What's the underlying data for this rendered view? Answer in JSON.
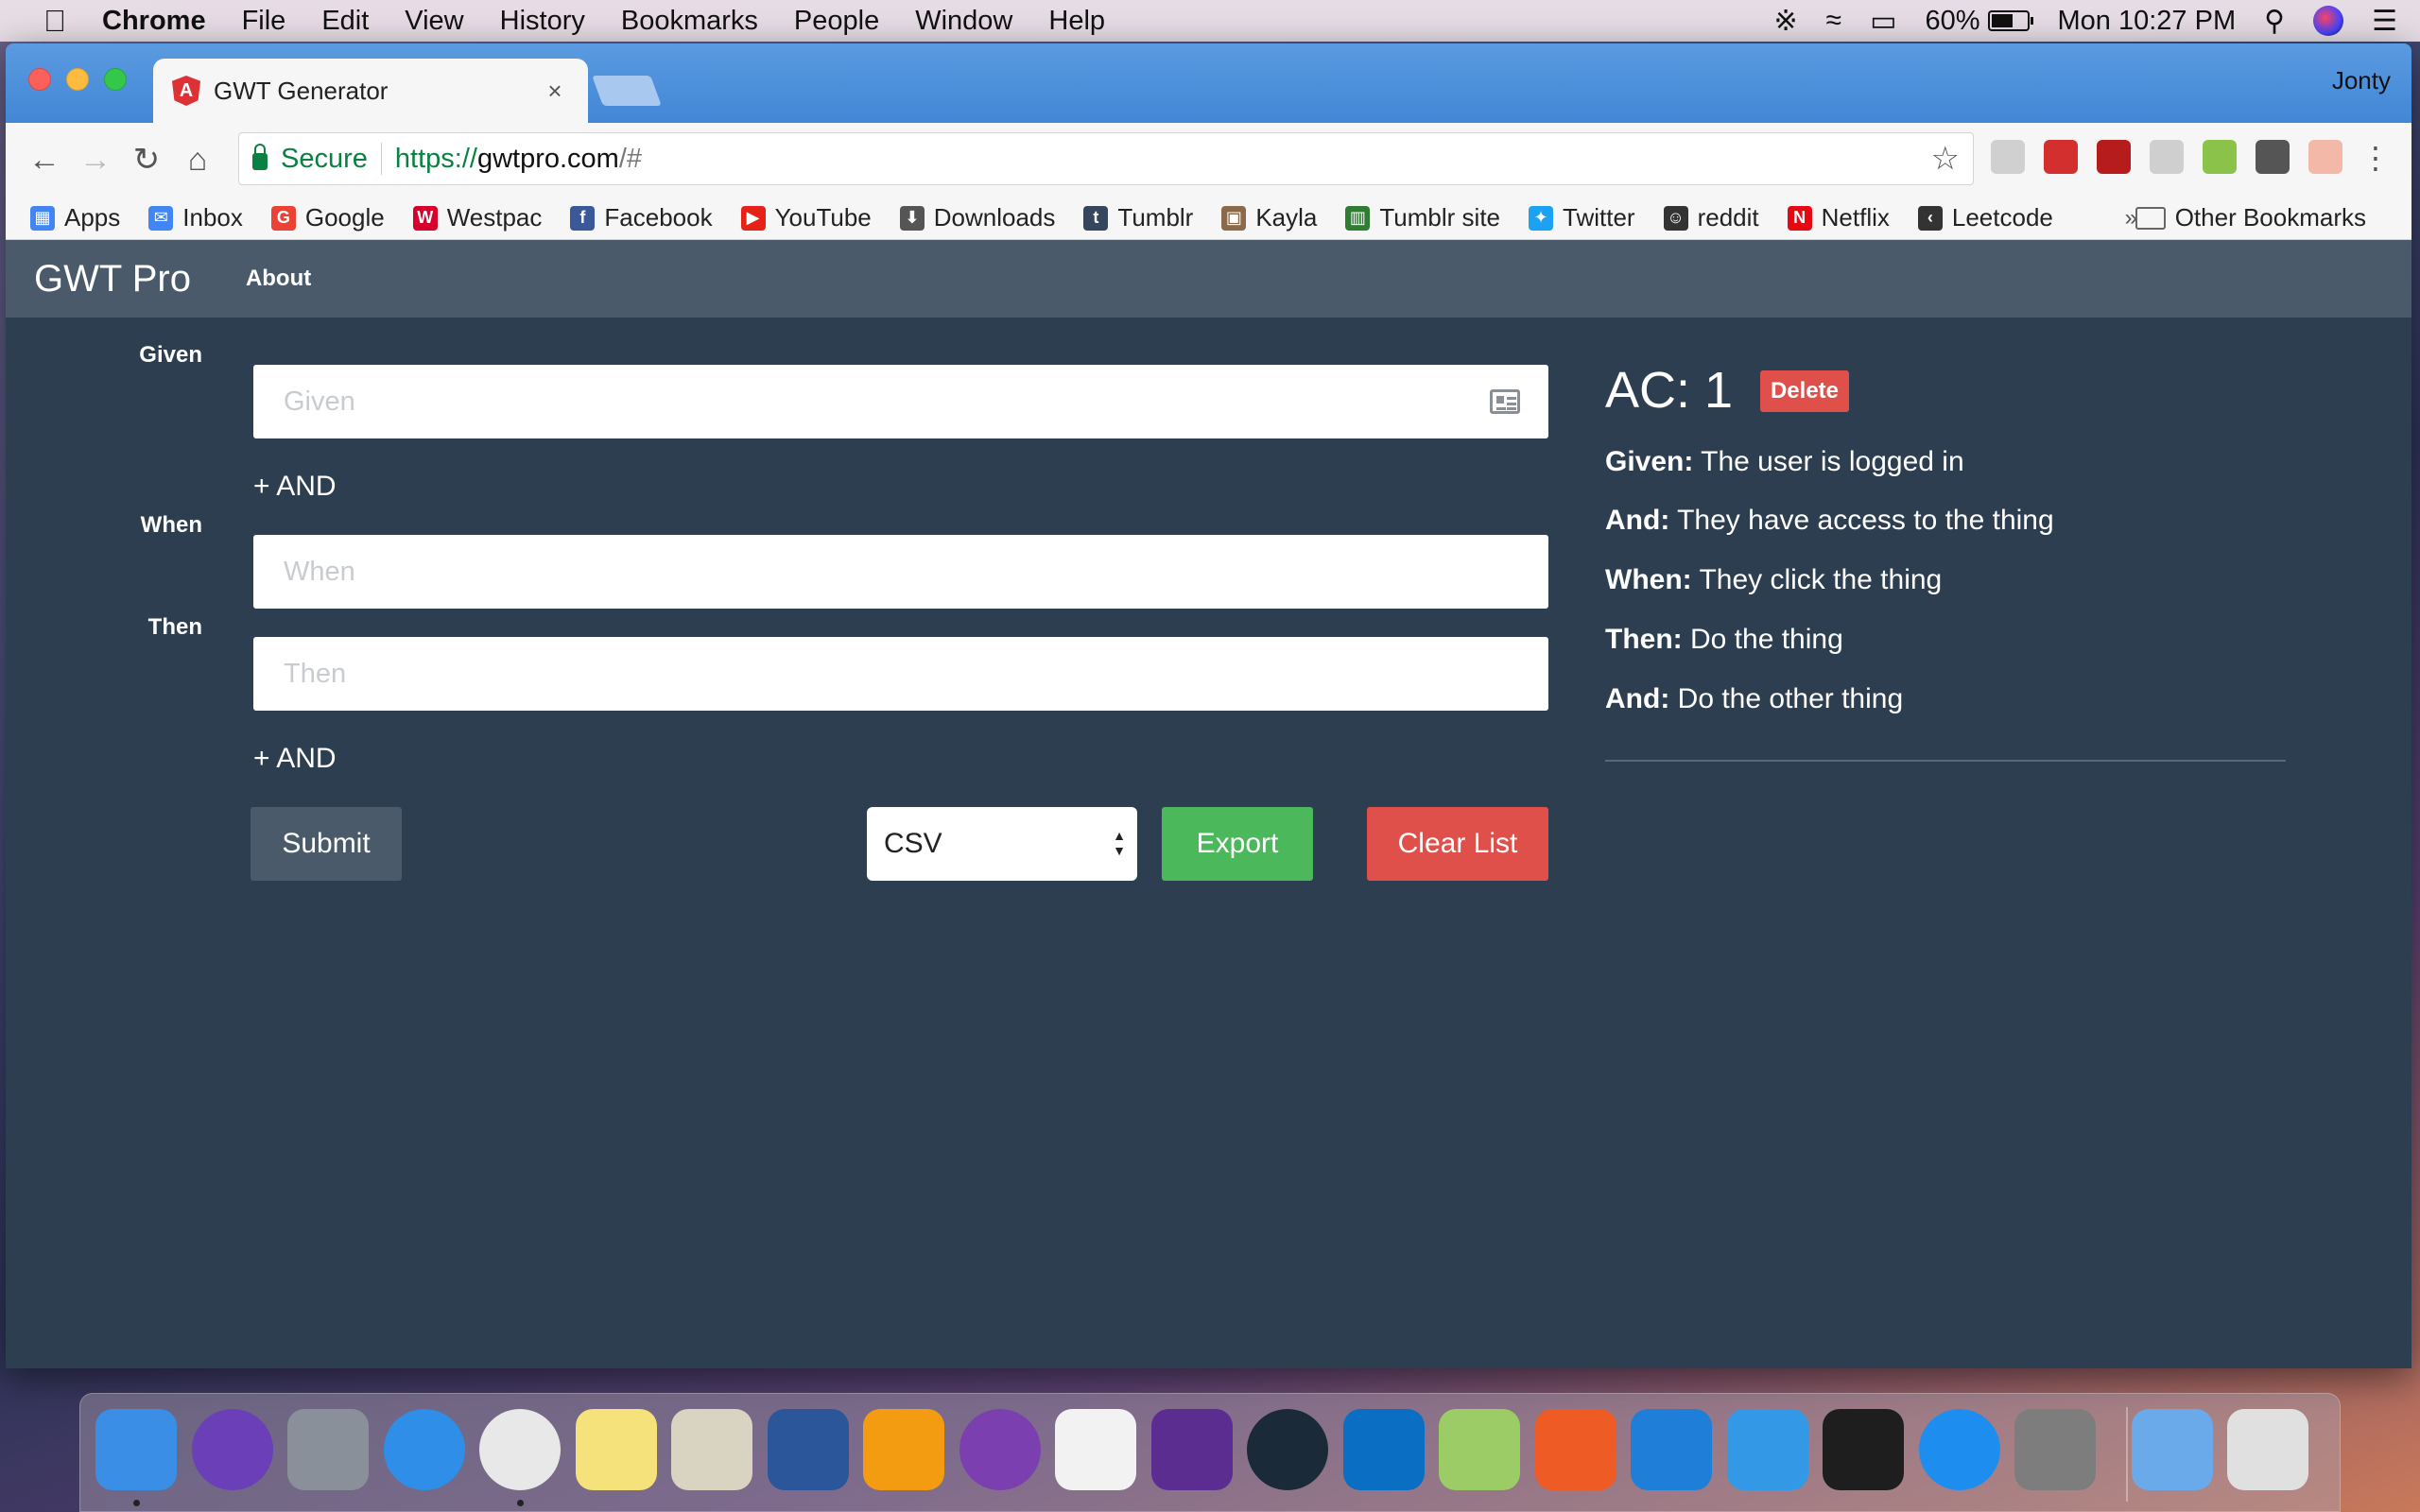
{
  "menubar": {
    "app_name": "Chrome",
    "menus": [
      "File",
      "Edit",
      "View",
      "History",
      "Bookmarks",
      "People",
      "Window",
      "Help"
    ],
    "battery_percent": "60%",
    "clock": "Mon 10:27 PM"
  },
  "browser": {
    "tab_title": "GWT Generator",
    "tab_close": "×",
    "profile_name": "Jonty",
    "secure_label": "Secure",
    "url_protocol": "https://",
    "url_host": "gwtpro.com",
    "url_path": "/#",
    "bookmarks": [
      {
        "label": "Apps",
        "icon": "apps-grid-icon",
        "color": "#4285f4"
      },
      {
        "label": "Inbox",
        "icon": "inbox-icon",
        "color": "#4285f4"
      },
      {
        "label": "Google",
        "icon": "google-icon",
        "color": "#ea4335"
      },
      {
        "label": "Westpac",
        "icon": "westpac-icon",
        "color": "#d5002b"
      },
      {
        "label": "Facebook",
        "icon": "facebook-icon",
        "color": "#3b5998"
      },
      {
        "label": "YouTube",
        "icon": "youtube-icon",
        "color": "#e62117"
      },
      {
        "label": "Downloads",
        "icon": "download-icon",
        "color": "#555555"
      },
      {
        "label": "Tumblr",
        "icon": "tumblr-icon",
        "color": "#36465d"
      },
      {
        "label": "Kayla",
        "icon": "photo-icon",
        "color": "#8a6a4a"
      },
      {
        "label": "Tumblr site",
        "icon": "tumblr-site-icon",
        "color": "#2e7d32"
      },
      {
        "label": "Twitter",
        "icon": "twitter-icon",
        "color": "#1da1f2"
      },
      {
        "label": "reddit",
        "icon": "reddit-icon",
        "color": "#333333"
      },
      {
        "label": "Netflix",
        "icon": "netflix-icon",
        "color": "#e50914"
      },
      {
        "label": "Leetcode",
        "icon": "leetcode-icon",
        "color": "#333333"
      }
    ],
    "bookmarks_overflow": "»",
    "other_bookmarks": "Other Bookmarks"
  },
  "app": {
    "brand": "GWT Pro",
    "nav_about": "About",
    "given_label": "Given",
    "given_placeholder": "Given",
    "when_label": "When",
    "when_placeholder": "When",
    "then_label": "Then",
    "then_placeholder": "Then",
    "add_and_label": "+ AND",
    "submit_label": "Submit",
    "export_format": "CSV",
    "export_label": "Export",
    "clear_label": "Clear List",
    "colors": {
      "background": "#2c3e50",
      "navbar": "#4b5a6b",
      "success": "#4cb85c",
      "danger": "#e0504a"
    }
  },
  "criteria": {
    "title": "AC: 1",
    "delete_label": "Delete",
    "lines": [
      {
        "key": "Given:",
        "text": "The user is logged in"
      },
      {
        "key": "And:",
        "text": "They have access to the thing"
      },
      {
        "key": "When:",
        "text": "They click the thing"
      },
      {
        "key": "Then:",
        "text": "Do the thing"
      },
      {
        "key": "And:",
        "text": "Do the other thing"
      }
    ]
  },
  "dock": {
    "apps": [
      "finder",
      "siri",
      "launchpad",
      "safari",
      "chrome",
      "notes",
      "preview",
      "word",
      "pages",
      "artstudio",
      "slack",
      "visual-studio",
      "gitkraken",
      "vscode",
      "android-studio",
      "postman",
      "xcode",
      "simulator",
      "terminal",
      "app-store",
      "system-preferences",
      "downloads-folder",
      "trash"
    ]
  }
}
